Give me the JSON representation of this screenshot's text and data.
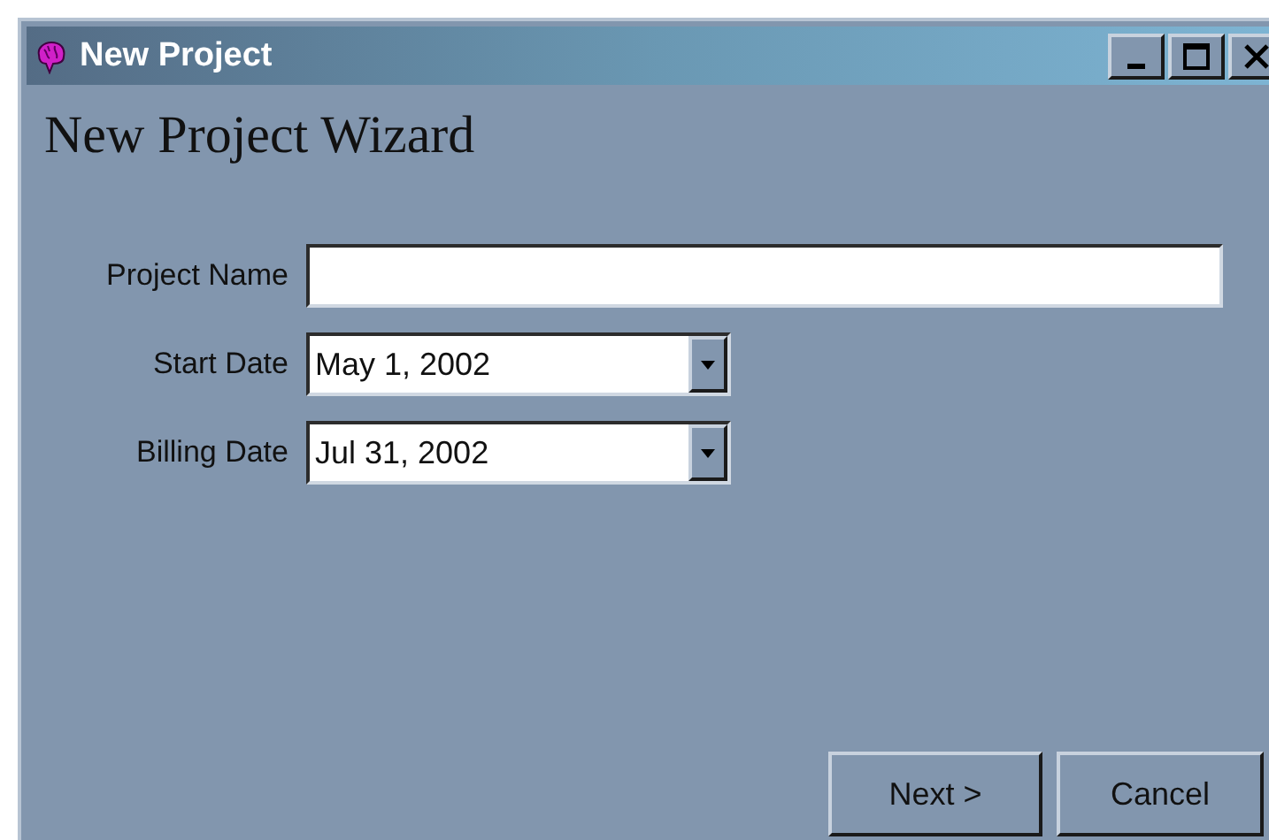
{
  "window": {
    "title": "New Project",
    "controls": [
      {
        "kind": "minimize"
      },
      {
        "kind": "maximize"
      },
      {
        "kind": "close"
      }
    ]
  },
  "heading": "New Project Wizard",
  "fields": [
    {
      "kind": "text",
      "label": "Project Name"
    },
    {
      "kind": "dropdown",
      "label": "Start Date",
      "value": "May 1, 2002"
    },
    {
      "kind": "dropdown",
      "label": "Billing Date",
      "value": "Jul 31, 2002"
    }
  ],
  "buttons": [
    "Next >",
    "Cancel"
  ]
}
